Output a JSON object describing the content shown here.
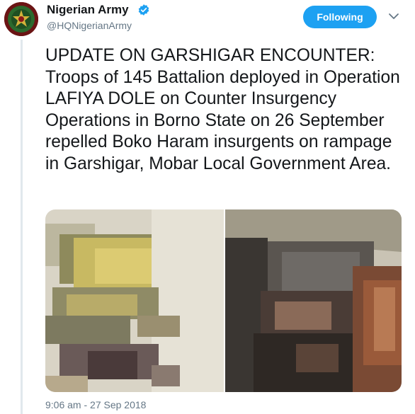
{
  "account": {
    "name": "Nigerian Army",
    "handle": "@HQNigerianArmy",
    "verified": true
  },
  "actions": {
    "follow_label": "Following",
    "more_icon": "chevron-down-icon"
  },
  "tweet": {
    "text": "UPDATE ON GARSHIGAR ENCOUNTER: Troops of 145 Battalion deployed in Operation LAFIYA DOLE on Counter Insurgency Operations in Borno State on 26 September repelled Boko Haram insurgents on rampage in Garshigar, Mobar Local Government Area.",
    "timestamp": "9:06 am - 27 Sep 2018",
    "media_count": 2
  },
  "colors": {
    "accent": "#1da1f2",
    "secondary_text": "#657786",
    "thread_line": "#e1e8ed"
  }
}
